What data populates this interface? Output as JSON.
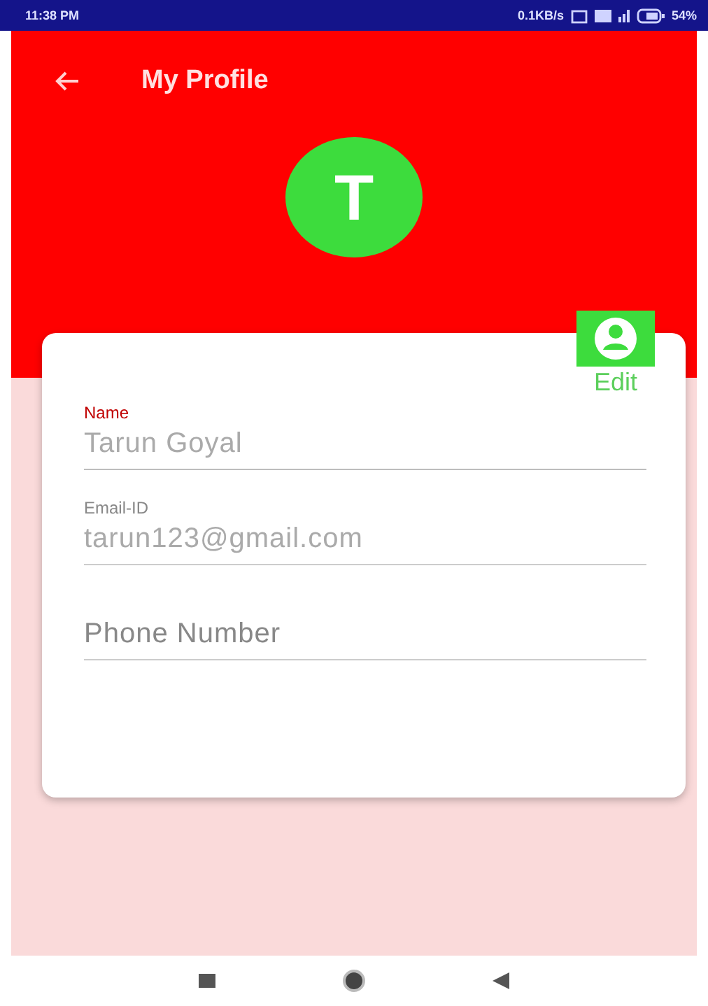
{
  "status_bar": {
    "time": "11:38 PM",
    "speed": "0.1KB/s",
    "battery": "54%"
  },
  "app_bar": {
    "title": "My Profile"
  },
  "avatar": {
    "initial": "T"
  },
  "edit": {
    "label": "Edit"
  },
  "fields": [
    {
      "label": "Name",
      "value": "Tarun Goyal",
      "focused": true
    },
    {
      "label": "Email-ID",
      "value": "tarun123@gmail.com",
      "focused": false
    },
    {
      "placeholder": "Phone Number",
      "focused": false
    }
  ]
}
